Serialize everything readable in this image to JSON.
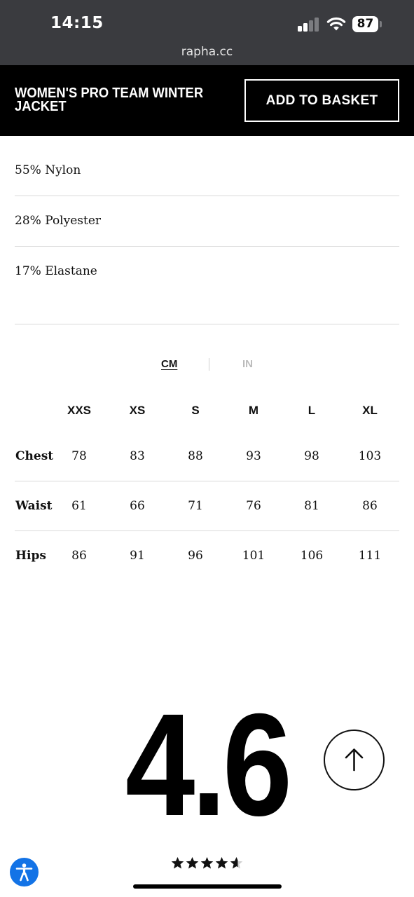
{
  "status_bar": {
    "time": "14:15",
    "battery": "87",
    "icons": [
      "cellular-signal-icon",
      "wifi-icon",
      "battery-icon"
    ]
  },
  "browser": {
    "url": "rapha.cc"
  },
  "product_bar": {
    "title": "WOMEN'S PRO TEAM WINTER JACKET",
    "add_to_basket": "ADD TO BASKET"
  },
  "materials": [
    "55% Nylon",
    "28% Polyester",
    "17% Elastane"
  ],
  "units": {
    "cm": "CM",
    "in": "IN",
    "selected": "CM"
  },
  "size_table": {
    "sizes": [
      "XXS",
      "XS",
      "S",
      "M",
      "L",
      "XL"
    ],
    "rows": [
      {
        "label": "Chest",
        "values": [
          "78",
          "83",
          "88",
          "93",
          "98",
          "103"
        ]
      },
      {
        "label": "Waist",
        "values": [
          "61",
          "66",
          "71",
          "76",
          "81",
          "86"
        ]
      },
      {
        "label": "Hips",
        "values": [
          "86",
          "91",
          "96",
          "101",
          "106",
          "111"
        ]
      }
    ]
  },
  "rating": {
    "score": "4.6",
    "stars": 4.6,
    "max_stars": 5
  },
  "icons": {
    "scroll_top": "arrow-up-icon",
    "accessibility": "accessibility-icon"
  },
  "colors": {
    "accessibility_blue": "#1373e6",
    "browser_chrome": "#3a3b3f",
    "product_bar": "#000000"
  }
}
